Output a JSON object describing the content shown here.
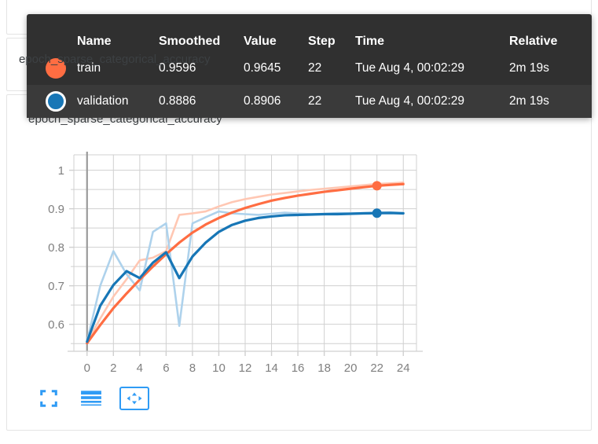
{
  "cards": {
    "mid_title": "epoch_sparse_categorical_accuracy",
    "main_title": "epoch_sparse_categorical_accuracy"
  },
  "toolbar_top": {
    "items": [
      {
        "name": "fullscreen-icon",
        "label": "Toggle fullscreen"
      },
      {
        "name": "data-series-icon",
        "label": "Toggle data table"
      },
      {
        "name": "pan-icon",
        "label": "Pan / fit domain"
      }
    ]
  },
  "toolbar_bottom": {
    "items": [
      {
        "name": "fullscreen-icon",
        "label": "Toggle fullscreen"
      },
      {
        "name": "data-series-icon",
        "label": "Toggle data table"
      },
      {
        "name": "pan-icon",
        "label": "Pan / fit domain"
      }
    ]
  },
  "tooltip": {
    "columns": [
      "Name",
      "Smoothed",
      "Value",
      "Step",
      "Time",
      "Relative"
    ],
    "rows": [
      {
        "marker": "filled",
        "color": "#ff6d42",
        "name": "train",
        "smoothed": "0.9596",
        "value": "0.9645",
        "step": "22",
        "time": "Tue Aug 4, 00:02:29",
        "relative": "2m 19s"
      },
      {
        "marker": "ring",
        "color": "#1776b6",
        "name": "validation",
        "smoothed": "0.8886",
        "value": "0.8906",
        "step": "22",
        "time": "Tue Aug 4, 00:02:29",
        "relative": "2m 19s"
      }
    ]
  },
  "colors": {
    "train": "#ff6d42",
    "validation": "#1776b6",
    "train_raw": "#ffc7b3",
    "validation_raw": "#aed2ec",
    "accent": "#2f9bf5",
    "grid": "#d0d0d0",
    "cursor": "#9a9a9a",
    "tooltip_bg": "#303030"
  },
  "chart_data": {
    "type": "line",
    "title": "epoch_sparse_categorical_accuracy",
    "xlabel": "",
    "ylabel": "",
    "xlim": [
      -1,
      25
    ],
    "ylim": [
      0.53,
      1.04
    ],
    "xticks": [
      0,
      2,
      4,
      6,
      8,
      10,
      12,
      14,
      16,
      18,
      20,
      22,
      24
    ],
    "yticks": [
      0.6,
      0.7,
      0.8,
      0.9,
      1
    ],
    "yticks_minor": [
      0.55,
      0.65,
      0.75,
      0.85,
      0.95
    ],
    "grid": true,
    "legend_position": "tooltip",
    "cursor_step": 0,
    "highlight_step": 22,
    "x": [
      0,
      1,
      2,
      3,
      4,
      5,
      6,
      7,
      8,
      9,
      10,
      11,
      12,
      13,
      14,
      15,
      16,
      17,
      18,
      19,
      20,
      21,
      22,
      23,
      24
    ],
    "series": [
      {
        "name": "train",
        "kind": "smoothed",
        "color": "#ff6d42",
        "values": [
          0.551,
          0.598,
          0.642,
          0.68,
          0.716,
          0.75,
          0.782,
          0.812,
          0.838,
          0.859,
          0.876,
          0.89,
          0.902,
          0.912,
          0.921,
          0.928,
          0.934,
          0.939,
          0.944,
          0.948,
          0.952,
          0.956,
          0.9596,
          0.962,
          0.964
        ]
      },
      {
        "name": "train_raw",
        "kind": "raw",
        "color": "#ffc7b3",
        "values": [
          0.553,
          0.615,
          0.672,
          0.717,
          0.766,
          0.773,
          0.79,
          0.884,
          0.888,
          0.893,
          0.906,
          0.917,
          0.925,
          0.931,
          0.937,
          0.941,
          0.945,
          0.949,
          0.952,
          0.955,
          0.958,
          0.961,
          0.9645,
          0.966,
          0.968
        ]
      },
      {
        "name": "validation",
        "kind": "smoothed",
        "color": "#1776b6",
        "values": [
          0.555,
          0.648,
          0.702,
          0.738,
          0.72,
          0.76,
          0.787,
          0.72,
          0.776,
          0.812,
          0.84,
          0.858,
          0.869,
          0.876,
          0.88,
          0.883,
          0.884,
          0.885,
          0.886,
          0.886,
          0.887,
          0.888,
          0.8886,
          0.889,
          0.888
        ]
      },
      {
        "name": "validation_raw",
        "kind": "raw",
        "color": "#aed2ec",
        "values": [
          0.556,
          0.7,
          0.79,
          0.73,
          0.688,
          0.84,
          0.862,
          0.596,
          0.862,
          0.878,
          0.893,
          0.888,
          0.886,
          0.884,
          0.887,
          0.89,
          0.888,
          0.886,
          0.887,
          0.889,
          0.888,
          0.889,
          0.8906,
          0.891,
          0.889
        ]
      }
    ]
  }
}
